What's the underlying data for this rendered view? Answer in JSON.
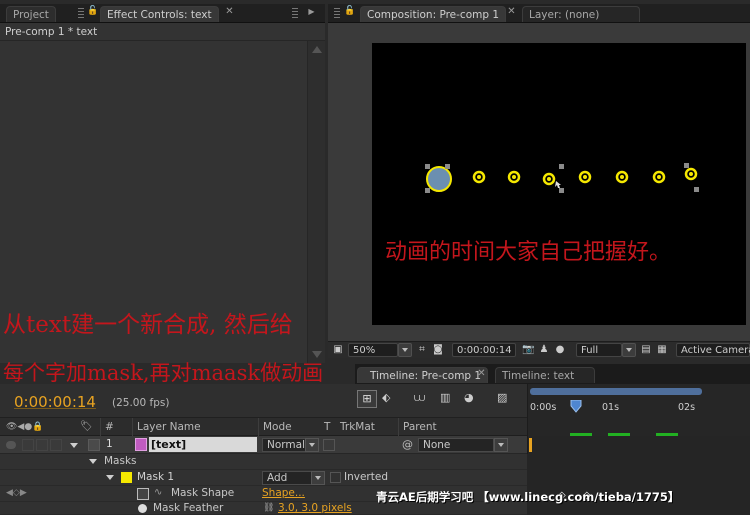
{
  "left_panel": {
    "tabs": [
      {
        "label": "Project"
      },
      {
        "label": "Effect Controls: text"
      }
    ],
    "header": "Pre-comp 1 * text"
  },
  "comp_panel": {
    "tabs": [
      {
        "label": "Composition: Pre-comp 1"
      },
      {
        "label": "Layer: (none)"
      }
    ],
    "toolbar": {
      "zoom": "50%",
      "timecode": "0:00:00:14",
      "resolution": "Full",
      "camera": "Active Camera"
    }
  },
  "captions": {
    "overlay_1": "动画的时间大家自己把握好。",
    "overlay_2": "从text建一个新合成, 然后给",
    "overlay_3": "每个字加mask,再对maask做动画"
  },
  "timeline": {
    "tabs": [
      {
        "label": "Timeline: Pre-comp 1"
      },
      {
        "label": "Timeline: text"
      }
    ],
    "current_time": "0:00:00:14",
    "fps": "(25.00 fps)",
    "columns": {
      "number": "#",
      "layer_name": "Layer Name",
      "mode": "Mode",
      "t": "T",
      "trkmat": "TrkMat",
      "parent": "Parent"
    },
    "ruler": {
      "t0": "0:00s",
      "t1": "01s",
      "t2": "02s"
    },
    "layer": {
      "index": "1",
      "name": "[text]",
      "mode": "Normal",
      "parent": "None"
    },
    "masks_label": "Masks",
    "mask": {
      "name": "Mask 1",
      "mode": "Add",
      "inverted_label": "Inverted",
      "shape_label": "Mask Shape",
      "shape_value": "Shape...",
      "feather_label": "Mask Feather",
      "feather_value": "3.0, 3.0 pixels"
    }
  },
  "watermark": "青云AE后期学习吧 【www.linecg.com/tieba/1775】",
  "colors": {
    "timecode": "#e8a321",
    "mask_yellow": "#f5e800",
    "caption_red": "#c4161c",
    "keyframe_green": "#22b022",
    "playhead": "#c8342b"
  }
}
